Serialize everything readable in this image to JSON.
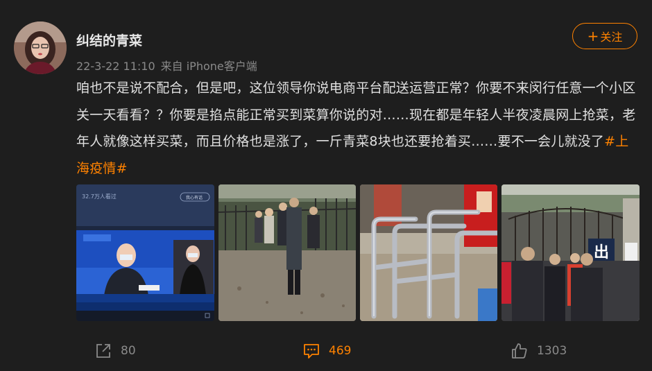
{
  "post": {
    "author": "纠结的青菜",
    "date": "22-3-22 11:10",
    "source": "来自 iPhone客户端",
    "follow_label": "关注",
    "follow_plus": "+",
    "text": "咱也不是说不配合，但是吧，这位领导你说电商平台配送运营正常？你要不来闵行任意一个小区关一天看看？？你要是掐点能正常买到菜算你说的对……现在都是年轻人半夜凌晨网上抢菜，老年人就像这样买菜，而且价格也是涨了，一斤青菜8块也还要抢着买……要不一会儿就没了",
    "hashtag": "#上海疫情#"
  },
  "images": {
    "photo1": {
      "viewers": "32.7万人看过",
      "button": "我心有话"
    },
    "photo4": {
      "sign": "出"
    }
  },
  "actions": {
    "repost_count": "80",
    "comment_count": "469",
    "like_count": "1303"
  },
  "colors": {
    "accent": "#ff8200",
    "background": "#1e1e1e",
    "text": "#e0e0e0",
    "muted": "#8a8a8a"
  }
}
